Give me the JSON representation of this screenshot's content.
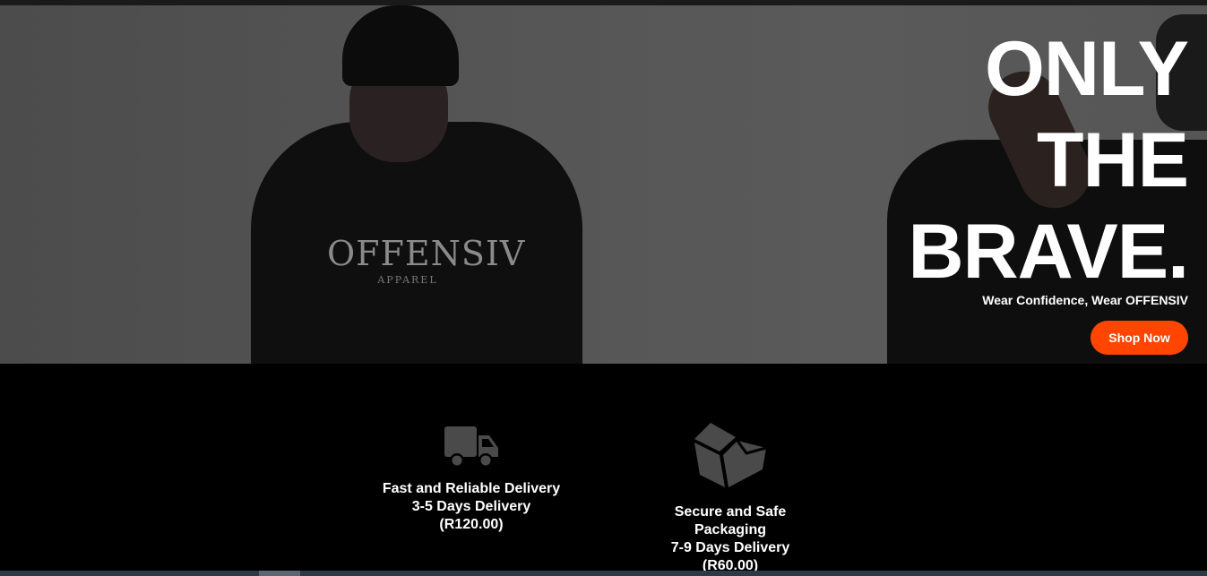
{
  "hero": {
    "title_lines": [
      "ONLY",
      "THE",
      "BRAVE."
    ],
    "subtitle": "Wear Confidence, Wear OFFENSIV",
    "cta_label": "Shop Now",
    "print_text": "OFFENSIV",
    "print_sub": "APPAREL"
  },
  "features": [
    {
      "icon": "delivery-truck-icon",
      "lines": [
        "Fast and Reliable Delivery",
        "3-5 Days Delivery",
        "(R120.00)"
      ]
    },
    {
      "icon": "package-box-icon",
      "lines": [
        "Secure and Safe",
        "Packaging",
        "7-9 Days Delivery",
        "(R60.00)"
      ]
    }
  ],
  "colors": {
    "accent": "#ff4500",
    "background": "#000000",
    "icon_gray": "#4a4a4a"
  }
}
